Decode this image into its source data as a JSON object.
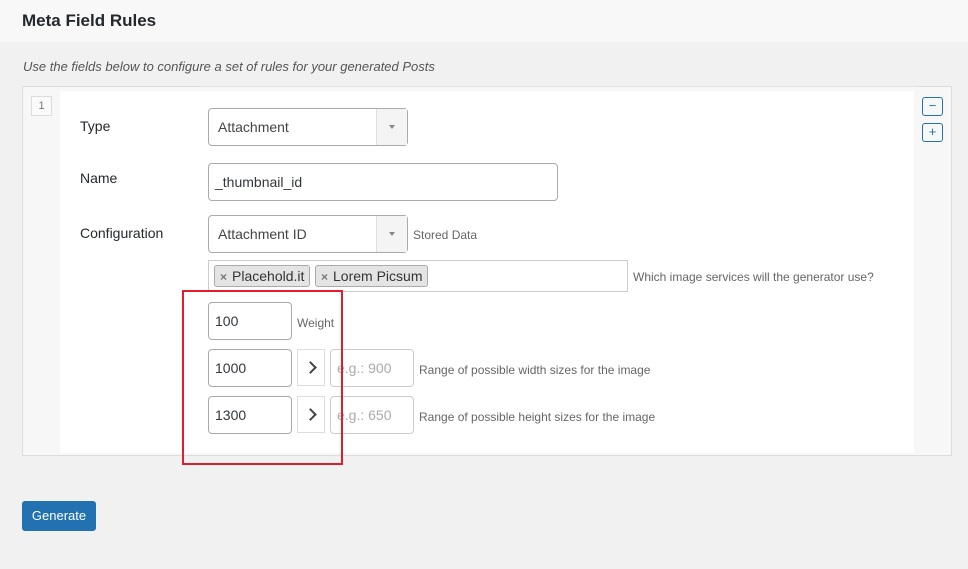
{
  "page": {
    "title": "Meta Field Rules",
    "description": "Use the fields below to configure a set of rules for your generated Posts"
  },
  "rule": {
    "number": "1",
    "remove_label": "−",
    "add_label": "+",
    "type": {
      "label": "Type",
      "value": "Attachment"
    },
    "name": {
      "label": "Name",
      "value": "_thumbnail_id"
    },
    "configuration": {
      "label": "Configuration",
      "value": "Attachment ID",
      "hint": "Stored Data"
    },
    "services": {
      "tags": [
        "Placehold.it",
        "Lorem Picsum"
      ],
      "hint": "Which image services will the generator use?"
    },
    "weight": {
      "value": "100",
      "hint": "Weight"
    },
    "width": {
      "min": "1000",
      "max_placeholder": "e.g.: 900",
      "hint": "Range of possible width sizes for the image"
    },
    "height": {
      "min": "1300",
      "max_placeholder": "e.g.: 650",
      "hint": "Range of possible height sizes for the image"
    }
  },
  "actions": {
    "generate_label": "Generate"
  },
  "colors": {
    "primary": "#2271b1",
    "highlight": "#e11d2b"
  }
}
